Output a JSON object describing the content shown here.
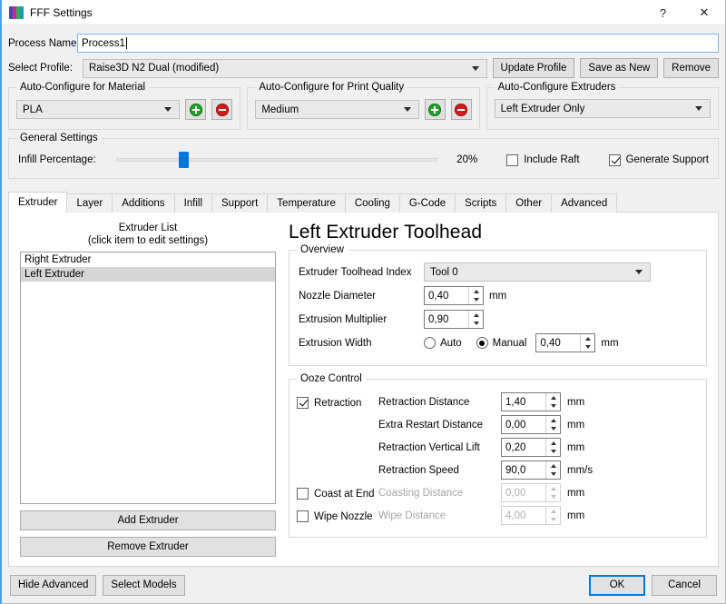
{
  "window": {
    "title": "FFF Settings",
    "icon": "app-stripes-icon",
    "help_label": "?",
    "close_label": "✕"
  },
  "header": {
    "process_name_label": "Process Name:",
    "process_name_value": "Process1",
    "select_profile_label": "Select Profile:",
    "select_profile_value": "Raise3D N2 Dual (modified)",
    "update_profile_label": "Update Profile",
    "save_as_new_label": "Save as New",
    "remove_label": "Remove"
  },
  "auto_configure": {
    "material": {
      "title": "Auto-Configure for Material",
      "value": "PLA",
      "add_label": "+",
      "remove_label": "−"
    },
    "quality": {
      "title": "Auto-Configure for Print Quality",
      "value": "Medium",
      "add_label": "+",
      "remove_label": "−"
    },
    "extruders": {
      "title": "Auto-Configure Extruders",
      "value": "Left Extruder Only"
    }
  },
  "general_settings": {
    "title": "General Settings",
    "infill_label": "Infill Percentage:",
    "infill_value": 20,
    "infill_display": "20%",
    "infill_min": 0,
    "infill_max": 100,
    "include_raft_label": "Include Raft",
    "include_raft_checked": false,
    "generate_support_label": "Generate Support",
    "generate_support_checked": true
  },
  "tabs": {
    "active": "Extruder",
    "items": [
      {
        "label": "Extruder"
      },
      {
        "label": "Layer"
      },
      {
        "label": "Additions"
      },
      {
        "label": "Infill"
      },
      {
        "label": "Support"
      },
      {
        "label": "Temperature"
      },
      {
        "label": "Cooling"
      },
      {
        "label": "G-Code"
      },
      {
        "label": "Scripts"
      },
      {
        "label": "Other"
      },
      {
        "label": "Advanced"
      }
    ]
  },
  "extruder_list": {
    "caption_line1": "Extruder List",
    "caption_line2": "(click item to edit settings)",
    "items": [
      {
        "label": "Right Extruder",
        "selected": false
      },
      {
        "label": "Left Extruder",
        "selected": true
      }
    ],
    "add_label": "Add Extruder",
    "remove_label": "Remove Extruder"
  },
  "toolhead": {
    "title": "Left Extruder Toolhead",
    "overview": {
      "title": "Overview",
      "index_label": "Extruder Toolhead Index",
      "index_value": "Tool 0",
      "nozzle_diameter_label": "Nozzle Diameter",
      "nozzle_diameter_value": "0,40",
      "nozzle_diameter_unit": "mm",
      "extrusion_multiplier_label": "Extrusion Multiplier",
      "extrusion_multiplier_value": "0,90",
      "extrusion_width_label": "Extrusion Width",
      "extrusion_width_auto_label": "Auto",
      "extrusion_width_manual_label": "Manual",
      "extrusion_width_mode": "Manual",
      "extrusion_width_value": "0,40",
      "extrusion_width_unit": "mm"
    },
    "ooze": {
      "title": "Ooze Control",
      "retraction_label": "Retraction",
      "retraction_checked": true,
      "coast_label": "Coast at End",
      "coast_checked": false,
      "wipe_label": "Wipe Nozzle",
      "wipe_checked": false,
      "fields": [
        {
          "label": "Retraction Distance",
          "value": "1,40",
          "unit": "mm",
          "disabled": false
        },
        {
          "label": "Extra Restart Distance",
          "value": "0,00",
          "unit": "mm",
          "disabled": false
        },
        {
          "label": "Retraction Vertical Lift",
          "value": "0,20",
          "unit": "mm",
          "disabled": false
        },
        {
          "label": "Retraction Speed",
          "value": "90,0",
          "unit": "mm/s",
          "disabled": false
        },
        {
          "label": "Coasting Distance",
          "value": "0,00",
          "unit": "mm",
          "disabled": true
        },
        {
          "label": "Wipe Distance",
          "value": "4,00",
          "unit": "mm",
          "disabled": true
        }
      ]
    }
  },
  "footer": {
    "hide_advanced_label": "Hide Advanced",
    "select_models_label": "Select Models",
    "ok_label": "OK",
    "cancel_label": "Cancel"
  },
  "colors": {
    "accent": "#0078d7",
    "window_border": "#4ba3e3",
    "background": "#f0f0f0",
    "add_green": "#22a12a",
    "remove_red": "#d01b1b"
  }
}
